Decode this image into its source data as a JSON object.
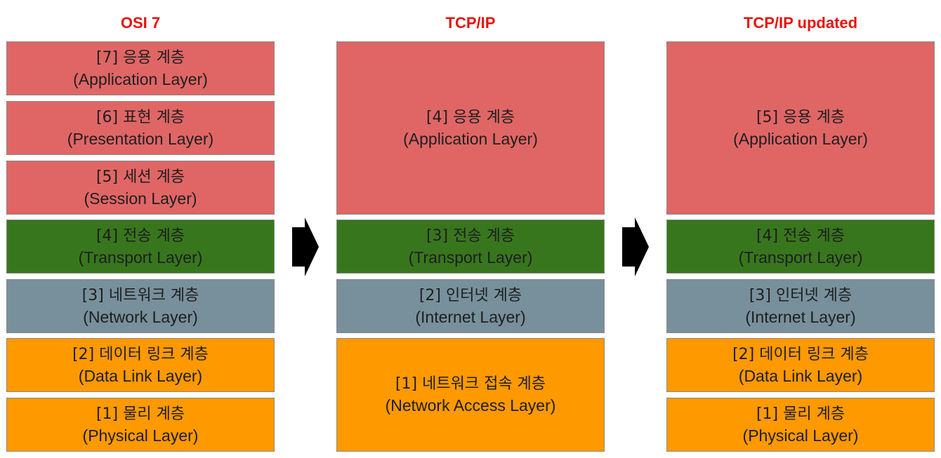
{
  "colors": {
    "title": "#e8120c",
    "application": "#e06666",
    "transport": "#38761d",
    "network": "#78909c",
    "link": "#ff9900",
    "border": "#8a8a8a",
    "arrow": "#000000"
  },
  "columns": [
    {
      "title": "OSI 7",
      "layers": [
        {
          "ko": "[7] 응용 계층",
          "en": "(Application Layer)",
          "type": "application"
        },
        {
          "ko": "[6] 표현 계층",
          "en": "(Presentation Layer)",
          "type": "application"
        },
        {
          "ko": "[5] 세션 계층",
          "en": "(Session Layer)",
          "type": "application"
        },
        {
          "ko": "[4] 전송 계층",
          "en": "(Transport Layer)",
          "type": "transport"
        },
        {
          "ko": "[3] 네트워크 계층",
          "en": "(Network Layer)",
          "type": "network"
        },
        {
          "ko": "[2] 데이터 링크 계층",
          "en": "(Data Link Layer)",
          "type": "link"
        },
        {
          "ko": "[1] 물리 계층",
          "en": "(Physical Layer)",
          "type": "link"
        }
      ]
    },
    {
      "title": "TCP/IP",
      "layers": [
        {
          "ko": "[4] 응용 계층",
          "en": "(Application Layer)",
          "type": "application"
        },
        {
          "ko": "[3] 전송 계층",
          "en": "(Transport Layer)",
          "type": "transport"
        },
        {
          "ko": "[2] 인터넷 계층",
          "en": "(Internet Layer)",
          "type": "network"
        },
        {
          "ko": "[1] 네트워크 접속 계층",
          "en": "(Network Access Layer)",
          "type": "link"
        }
      ]
    },
    {
      "title": "TCP/IP updated",
      "layers": [
        {
          "ko": "[5] 응용 계층",
          "en": "(Application Layer)",
          "type": "application"
        },
        {
          "ko": "[4] 전송 계층",
          "en": "(Transport Layer)",
          "type": "transport"
        },
        {
          "ko": "[3] 인터넷 계층",
          "en": "(Internet Layer)",
          "type": "network"
        },
        {
          "ko": "[2] 데이터 링크 계층",
          "en": "(Data Link Layer)",
          "type": "link"
        },
        {
          "ko": "[1] 물리 계층",
          "en": "(Physical Layer)",
          "type": "link"
        }
      ]
    }
  ],
  "arrows": [
    {
      "icon": "right-arrow-icon"
    },
    {
      "icon": "right-arrow-icon"
    }
  ]
}
